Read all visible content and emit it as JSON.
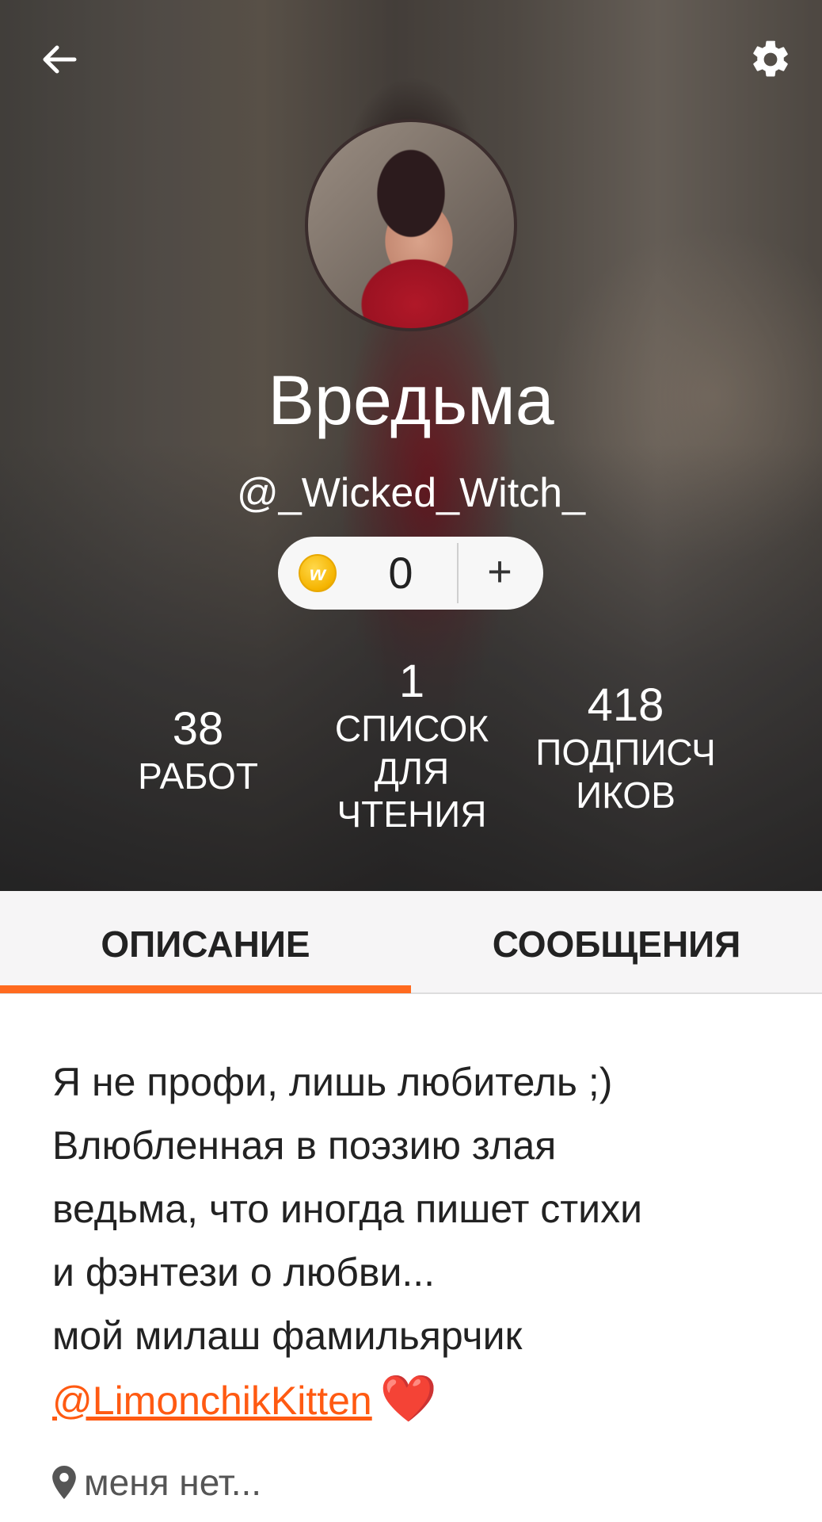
{
  "header": {
    "back_icon": "back-arrow-icon",
    "settings_icon": "gear-icon"
  },
  "profile": {
    "display_name": "Вредьма",
    "username": "@_Wicked_Witch_"
  },
  "coins": {
    "count": "0",
    "add_label": "+",
    "coin_glyph": "w"
  },
  "stats": {
    "works": {
      "value": "38",
      "label": "РАБОТ"
    },
    "reading_lists": {
      "value": "1",
      "label_lines": [
        "СПИСОК",
        "ДЛЯ",
        "ЧТЕНИЯ"
      ]
    },
    "followers": {
      "value": "418",
      "label_lines": [
        "ПОДПИСЧ",
        "ИКОВ"
      ]
    }
  },
  "tabs": [
    {
      "label": "ОПИСАНИЕ",
      "active": true
    },
    {
      "label": "СООБЩЕНИЯ",
      "active": false
    }
  ],
  "about": {
    "lines": [
      "Я не профи, лишь любитель ;)",
      "Влюбленная в поэзию злая",
      "ведьма, что иногда пишет стихи",
      "и фэнтези о любви...",
      "мой милаш фамильярчик"
    ],
    "mention": "@LimonchikKitten",
    "emoji": "❤️"
  },
  "location": {
    "text": "меня нет..."
  },
  "colors": {
    "accent": "#ff6a1f",
    "mention": "#ff5a12"
  }
}
